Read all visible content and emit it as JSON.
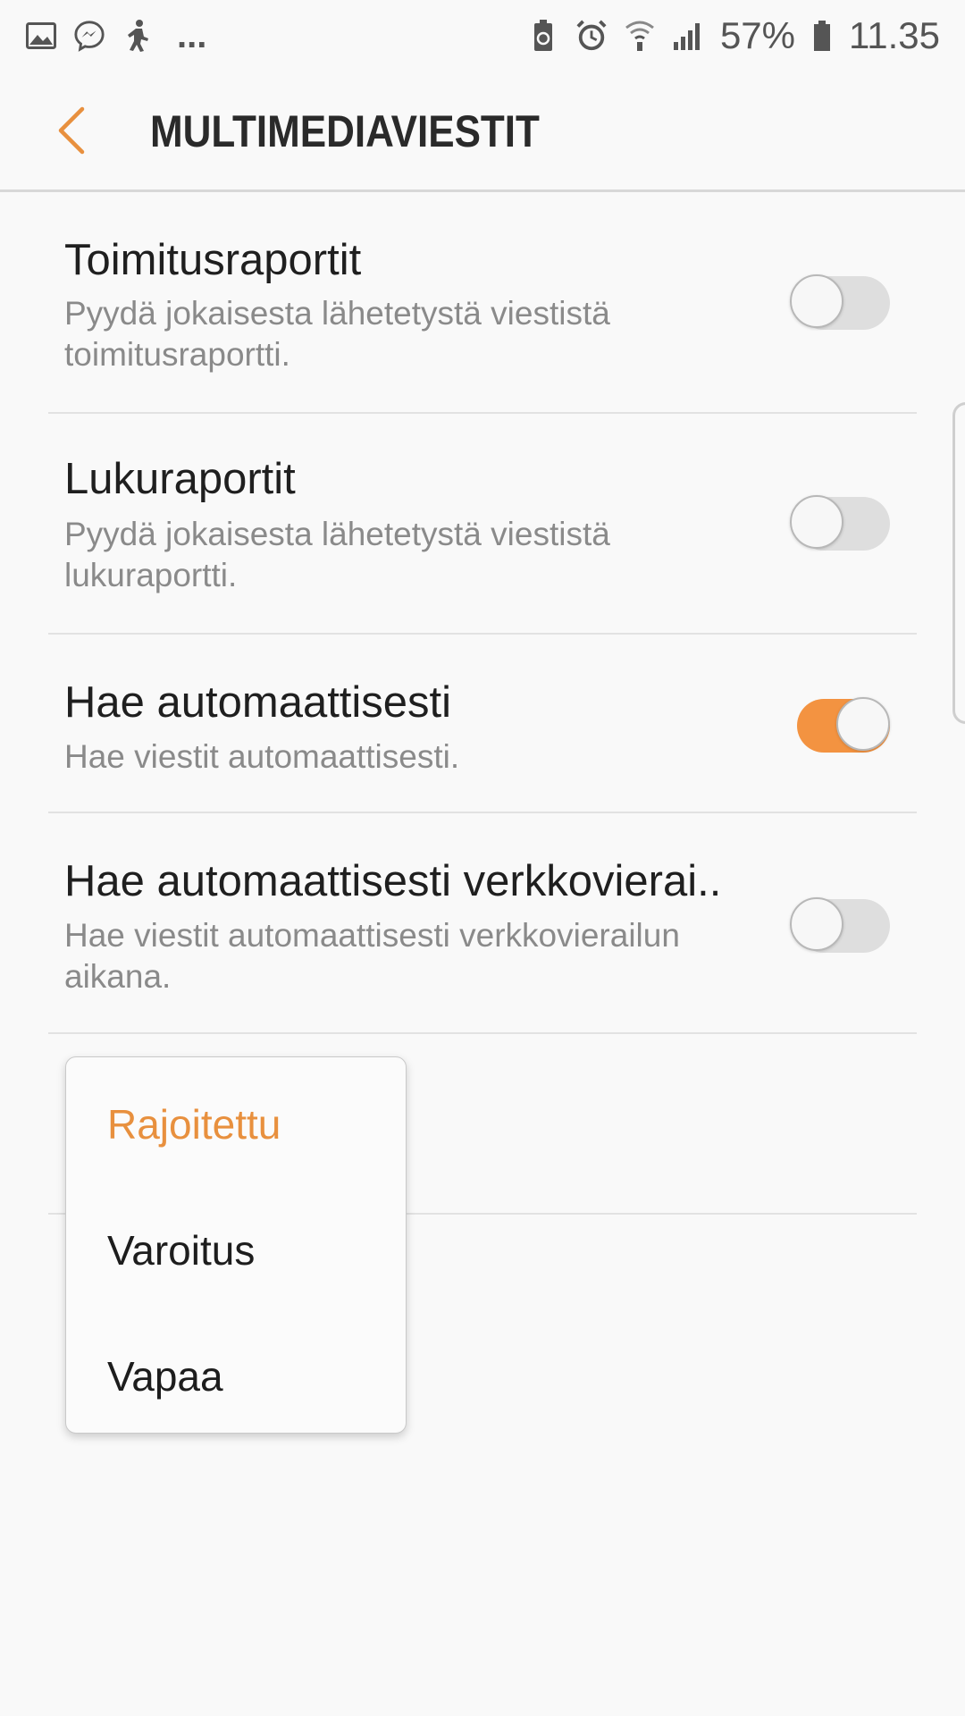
{
  "status_bar": {
    "battery_percent": "57%",
    "time": "11.35",
    "overflow": "...",
    "left_icons": [
      "gallery-icon",
      "messenger-icon",
      "fitness-icon"
    ],
    "right_icons": [
      "battery-saver-icon",
      "alarm-icon",
      "wifi-icon",
      "signal-icon",
      "battery-icon"
    ]
  },
  "header": {
    "title": "MULTIMEDIAVIESTIT",
    "back_icon": "back-chevron-icon"
  },
  "settings": [
    {
      "title": "Toimitusraportit",
      "subtitle": "Pyydä jokaisesta lähetetystä viestistä toimitusraportti.",
      "toggle_on": false
    },
    {
      "title": "Lukuraportit",
      "subtitle": "Pyydä jokaisesta lähetetystä viestistä lukuraportti.",
      "toggle_on": false
    },
    {
      "title": "Hae automaattisesti",
      "subtitle": "Hae viestit automaattisesti.",
      "toggle_on": true
    },
    {
      "title": "Hae automaattisesti verkkovierai..",
      "subtitle": "Hae viestit automaattisesti verkkovierailun aikana.",
      "toggle_on": false
    }
  ],
  "dropdown": {
    "options": [
      "Rajoitettu",
      "Varoitus",
      "Vapaa"
    ],
    "selected": "Rajoitettu"
  },
  "colors": {
    "accent": "#f39341",
    "selected_text": "#e8903e",
    "background": "#f9f9f9",
    "toggle_off_track": "#dedede"
  }
}
